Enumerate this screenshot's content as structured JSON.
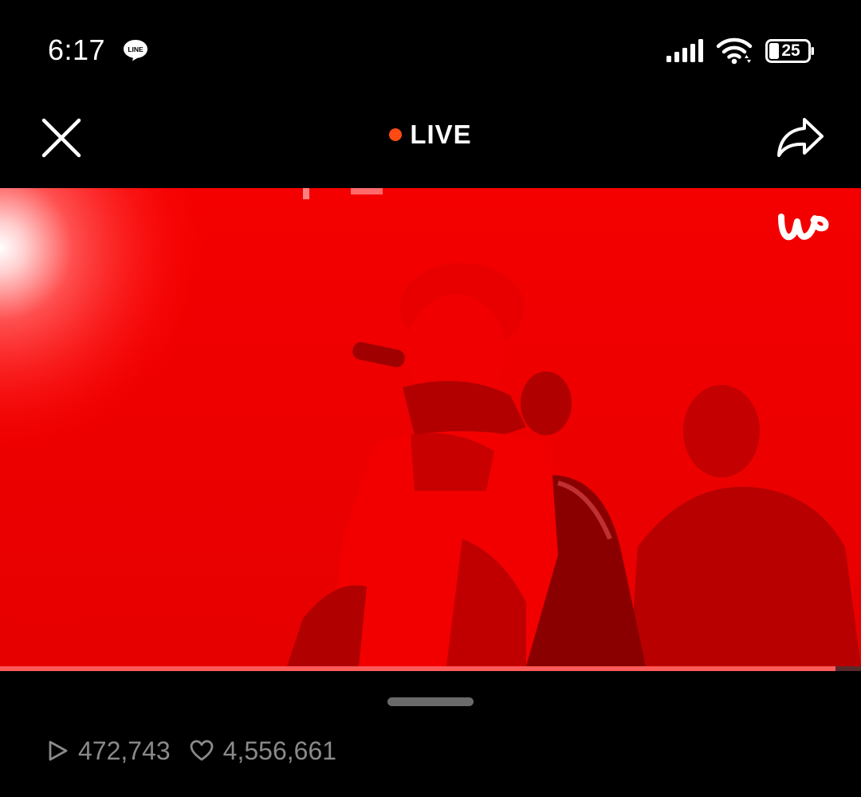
{
  "status_bar": {
    "time": "6:17",
    "notification_app": "LINE",
    "battery_level": "25",
    "icons": [
      "line-app-icon",
      "signal-icon",
      "wifi-icon",
      "battery-icon"
    ]
  },
  "nav": {
    "close_icon": "close-icon",
    "live_label": "LIVE",
    "share_icon": "share-icon",
    "live_dot_color": "#ff4a14"
  },
  "video": {
    "watermark_icon": "weverse-logo",
    "progress_fraction": 0.97,
    "dominant_color": "#ee0000"
  },
  "stats": {
    "plays_icon": "play-icon",
    "plays": "472,743",
    "likes_icon": "heart-icon",
    "likes": "4,556,661"
  }
}
